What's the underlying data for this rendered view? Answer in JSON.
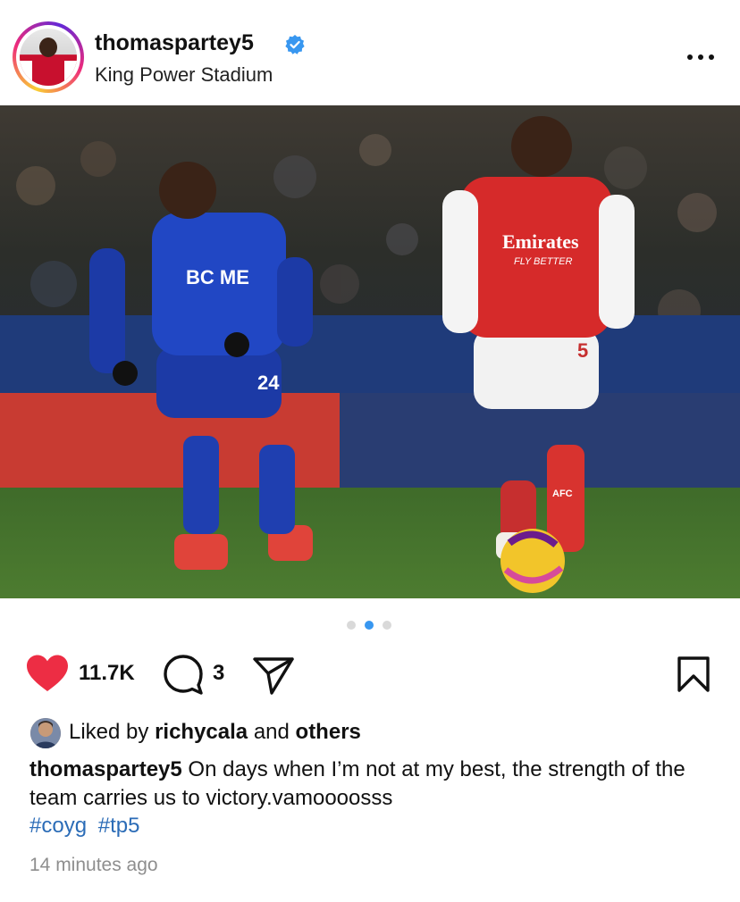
{
  "post": {
    "username": "thomaspartey5",
    "location": "King Power Stadium"
  },
  "photo": {
    "home_shirt_text": "Emirates",
    "home_shirt_subtext": "FLY BETTER",
    "home_number": "5",
    "away_number": "24",
    "sock_text": "AFC"
  },
  "carousel": {
    "current_index": 2,
    "total": 3
  },
  "actions": {
    "like_count": "11.7K",
    "comment_count": "3"
  },
  "likes": {
    "prefix": "Liked by",
    "user": "richycala",
    "connector": "and",
    "others": "others"
  },
  "caption": {
    "username": "thomaspartey5",
    "text": "On days when I’m not at my best, the strength of the team carries us to victory.vamoooosss",
    "hashtags": [
      "#coyg",
      "#tp5"
    ]
  },
  "timestamp": "14 minutes ago",
  "colors": {
    "like_red": "#ed2d44",
    "link_blue": "#2b6cb7",
    "verified_blue": "#3897f0",
    "active_dot": "#3897f0"
  }
}
